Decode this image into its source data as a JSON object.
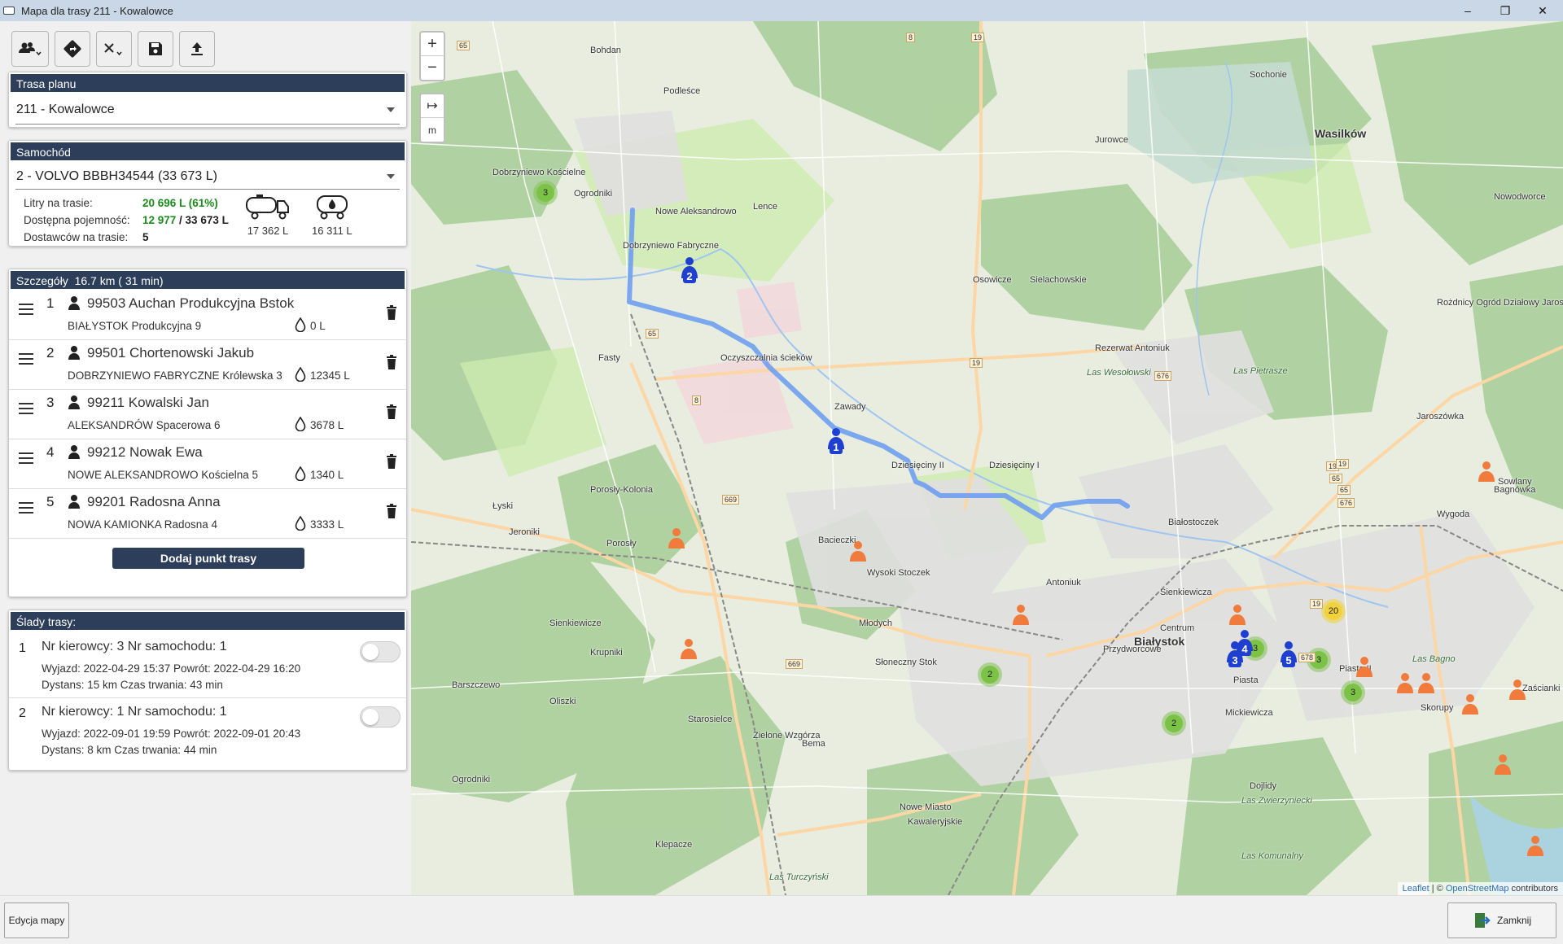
{
  "window": {
    "title": "Mapa dla trasy 211 - Kowalowce",
    "minimize": "–",
    "maximize": "❐",
    "close": "✕"
  },
  "toolbar": {
    "drivers": "drivers-icon",
    "route": "route-icon",
    "remove": "remove-icon",
    "save": "save-icon",
    "upload": "upload-icon"
  },
  "route_plan": {
    "header": "Trasa planu",
    "value": "211 - Kowalowce"
  },
  "vehicle": {
    "header": "Samochód",
    "value": "2 - VOLVO BBBH34544 (33 673 L)",
    "liters_label": "Litry na trasie:",
    "liters_value": "20 696 L (61%)",
    "capacity_label": "Dostępna pojemność:",
    "capacity_free": "12 977",
    "capacity_total": " / 33 673 L",
    "suppliers_label": "Dostawców na trasie:",
    "suppliers_value": "5",
    "tank1": "17 362 L",
    "tank2": "16 311 L"
  },
  "details": {
    "header": "Szczegóły",
    "summary": "16.7 km ( 31 min)",
    "items": [
      {
        "no": "1",
        "title": "99503 Auchan Produkcyjna Bstok",
        "address": "BIAŁYSTOK Produkcyjna 9",
        "liters": "0 L"
      },
      {
        "no": "2",
        "title": "99501 Chortenowski Jakub",
        "address": "DOBRZYNIEWO FABRYCZNE Królewska 3",
        "liters": "12345 L"
      },
      {
        "no": "3",
        "title": "99211 Kowalski Jan",
        "address": "ALEKSANDRÓW Spacerowa 6",
        "liters": "3678 L"
      },
      {
        "no": "4",
        "title": "99212 Nowak Ewa",
        "address": "NOWE ALEKSANDROWO Kościelna 5",
        "liters": "1340 L"
      },
      {
        "no": "5",
        "title": "99201 Radosna Anna",
        "address": "NOWA KAMIONKA Radosna 4",
        "liters": "3333 L"
      }
    ],
    "add_button": "Dodaj punkt trasy"
  },
  "traces": {
    "header": "Ślady trasy:",
    "items": [
      {
        "no": "1",
        "line1": "Nr kierowcy: 3 Nr samochodu: 1",
        "line2": "Wyjazd: 2022-04-29 15:37 Powrót: 2022-04-29 16:20",
        "line3": "Dystans: 15 km Czas trwania: 43 min"
      },
      {
        "no": "2",
        "line1": "Nr kierowcy: 1 Nr samochodu: 1",
        "line2": "Wyjazd: 2022-09-01 19:59 Powrót: 2022-09-01 20:43",
        "line3": "Dystans: 8 km Czas trwania: 44 min"
      }
    ]
  },
  "map": {
    "zoom_in": "+",
    "zoom_out": "−",
    "measure": "↦",
    "unit": "m",
    "labels": [
      "Bohdan",
      "Podleśce",
      "Sochonie",
      "Wasilków",
      "Jurowce",
      "Nowodworce",
      "Dobrzyniewo Kościelne",
      "Ogrodniki",
      "Nowe Aleksandrowo",
      "Lence",
      "Dobrzyniewo Fabryczne",
      "Osowicze",
      "Sielachowskie",
      "Rezerwat Antoniuk",
      "Las Wesołowski",
      "Las Pietraszе",
      "Fasty",
      "Oczyszczalnia ścieków",
      "Zawady",
      "Jaroszówka",
      "Bagnówka",
      "Sowlany",
      "Dziesięciny II",
      "Dziesięciny I",
      "Wygoda",
      "Białostoczek",
      "Porosły-Kolonia",
      "Łyski",
      "Jeroniki",
      "Porosły",
      "Bacieczki",
      "Wysoki Stoczek",
      "Antoniuk",
      "Sienkiewicza",
      "Centrum",
      "Białystok",
      "Przydworcowe",
      "Piasta II",
      "Las Bagno",
      "Zaścianki",
      "Sienkiewicze",
      "Krupniki",
      "Młodych",
      "Słoneczny Stok",
      "Piasta",
      "Skorupy",
      "Barszczewo",
      "Oliszki",
      "Starosielce",
      "Zielone Wzgórza",
      "Mickiewicza",
      "Bema",
      "Dojlidy",
      "Ogrodniki",
      "Nowe Miasto",
      "Kawaleryjskie",
      "Klepacze",
      "Las Turczyński",
      "Las Zwierzyniecki",
      "Las Komunalny",
      "Rożdnicy Ogród Działowy Jaroszówka"
    ],
    "attribution_leaflet": "Leaflet",
    "attribution_sep": " | © ",
    "attribution_osm": "OpenStreetMap",
    "attribution_rest": " contributors",
    "markers": [
      {
        "label": "1"
      },
      {
        "label": "2"
      },
      {
        "label": "3"
      },
      {
        "label": "4"
      },
      {
        "label": "5"
      }
    ],
    "clusters": [
      "3",
      "2",
      "3",
      "3",
      "3",
      "2",
      "20"
    ],
    "road_numbers": [
      "65",
      "8",
      "19",
      "65",
      "8",
      "19",
      "676",
      "19",
      "65",
      "19",
      "65",
      "676",
      "669",
      "669",
      "678",
      "19"
    ],
    "colors": {
      "route": "#6f9ef0",
      "marker": "#1f3fd0",
      "supplier": "#f07b3c",
      "cluster": "#7cc247"
    }
  },
  "bottom": {
    "edit_map": "Edycja mapy",
    "close": "Zamknij"
  }
}
